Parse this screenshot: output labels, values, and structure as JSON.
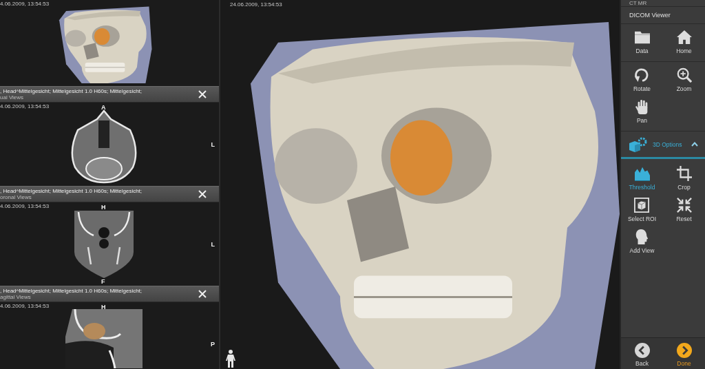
{
  "left_panel": {
    "viewports": [
      {
        "kind": "volume",
        "date": "4.06.2009, 13:54:53"
      },
      {
        "kind": "axial",
        "header": {
          "line_1": ", Head^Mittelgesicht; Mittelgesicht 1.0 H60s; Mittelgesicht;",
          "line_2": "ual Views"
        },
        "date": "4.06.2009, 13:54:53",
        "orientation": {
          "top": "A",
          "right": "L"
        }
      },
      {
        "kind": "coronal",
        "header": {
          "line_1": ", Head^Mittelgesicht; Mittelgesicht 1.0 H60s; Mittelgesicht;",
          "line_2": "oronal Views"
        },
        "date": "4.06.2009, 13:54:53",
        "orientation": {
          "top": "H",
          "right": "L",
          "bottom": "F"
        }
      },
      {
        "kind": "sagittal",
        "header": {
          "line_1": ", Head^Mittelgesicht; Mittelgesicht 1.0 H60s; Mittelgesicht;",
          "line_2": "agittal Views"
        },
        "date": "4.06.2009, 13:54:53",
        "orientation": {
          "top": "H",
          "right": "P"
        }
      }
    ]
  },
  "main_view": {
    "date": "24.06.2009, 13:54:53"
  },
  "sidebar": {
    "mode": "CT MR",
    "title": "DICOM Viewer",
    "groups": [
      {
        "tools": [
          {
            "kind": "data",
            "label": "Data",
            "selected": false
          },
          {
            "kind": "home",
            "label": "Home",
            "selected": false
          }
        ]
      },
      {
        "tools": [
          {
            "kind": "rotate",
            "label": "Rotate",
            "selected": false
          },
          {
            "kind": "zoom",
            "label": "Zoom",
            "selected": false
          },
          {
            "kind": "pan",
            "label": "Pan",
            "selected": false
          }
        ]
      }
    ],
    "section": {
      "label": "3D Options",
      "expanded": true,
      "tools": [
        {
          "kind": "threshold",
          "label": "Threshold",
          "selected": true
        },
        {
          "kind": "crop",
          "label": "Crop",
          "selected": false
        },
        {
          "kind": "select_roi",
          "label": "Select ROI",
          "selected": false
        },
        {
          "kind": "reset",
          "label": "Reset",
          "selected": false
        },
        {
          "kind": "add_view",
          "label": "Add View",
          "selected": false
        }
      ]
    },
    "footer": [
      {
        "kind": "back",
        "label": "Back"
      },
      {
        "kind": "done",
        "label": "Done"
      }
    ]
  }
}
